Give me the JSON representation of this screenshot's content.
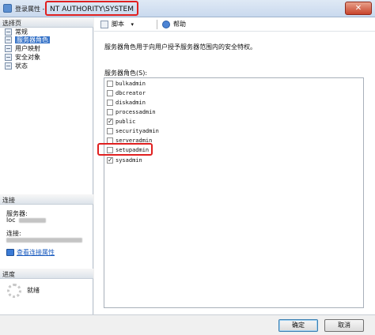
{
  "window": {
    "title": "登录属性 -",
    "login_name": "NT AUTHORITY\\SYSTEM",
    "close_symbol": "✕"
  },
  "left": {
    "select_page_header": "选择页",
    "pages": [
      {
        "label": "常规",
        "selected": false,
        "icon": "page-icon"
      },
      {
        "label": "服务器角色",
        "selected": true,
        "icon": "page-icon"
      },
      {
        "label": "用户映射",
        "selected": false,
        "icon": "page-icon"
      },
      {
        "label": "安全对象",
        "selected": false,
        "icon": "page-icon"
      },
      {
        "label": "状态",
        "selected": false,
        "icon": "page-icon"
      }
    ],
    "connection_header": "连接",
    "server_label": "服务器:",
    "server_value": "loc",
    "connection_label": "连接:",
    "connection_value": "",
    "view_connection_link": "查看连接属性",
    "progress_header": "进度",
    "progress_status": "就绪"
  },
  "toolbar": {
    "script_label": "脚本",
    "help_label": "帮助"
  },
  "main": {
    "description": "服务器角色用于向用户授予服务器范围内的安全特权。",
    "roles_label": "服务器角色(S):",
    "roles": [
      {
        "name": "bulkadmin",
        "checked": false
      },
      {
        "name": "dbcreator",
        "checked": false
      },
      {
        "name": "diskadmin",
        "checked": false
      },
      {
        "name": "processadmin",
        "checked": false
      },
      {
        "name": "public",
        "checked": true
      },
      {
        "name": "securityadmin",
        "checked": false
      },
      {
        "name": "serveradmin",
        "checked": false
      },
      {
        "name": "setupadmin",
        "checked": false
      },
      {
        "name": "sysadmin",
        "checked": true
      }
    ]
  },
  "buttons": {
    "ok": "确定",
    "cancel": "取消"
  },
  "colors": {
    "highlight_border": "#e02020",
    "selection": "#3874c8",
    "link": "#1a5bbf"
  }
}
